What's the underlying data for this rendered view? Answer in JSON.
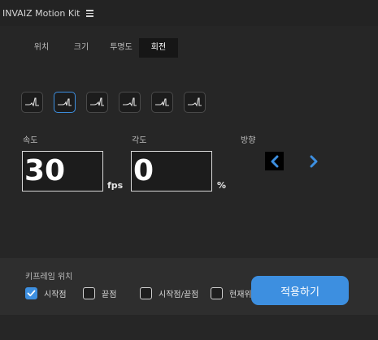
{
  "app": {
    "title": "INVAIZ Motion Kit"
  },
  "tabs": [
    {
      "label": "위치"
    },
    {
      "label": "크기"
    },
    {
      "label": "투명도"
    },
    {
      "label": "회전"
    }
  ],
  "selected_tab": "회전",
  "easing_presets": {
    "count": 6,
    "selected_index": 1
  },
  "fields": {
    "speed": {
      "label": "속도",
      "value": "30",
      "unit": "fps"
    },
    "angle": {
      "label": "각도",
      "value": "0",
      "unit": "%"
    }
  },
  "direction": {
    "label": "방향"
  },
  "keyframe": {
    "label": "키프레임 위치",
    "options": [
      {
        "label": "시작점",
        "checked": true
      },
      {
        "label": "끝점",
        "checked": false
      },
      {
        "label": "시작점/끝점",
        "checked": false
      },
      {
        "label": "현재위치",
        "checked": false
      }
    ]
  },
  "apply": {
    "label": "적용하기"
  },
  "colors": {
    "accent": "#3d8fe0",
    "background": "#262626",
    "bottom_panel": "#2e2e2e"
  },
  "icons": {
    "menu": "hamburger-icon",
    "easing": "easing-curve-icon",
    "left": "chevron-left-icon",
    "right": "chevron-right-icon",
    "check": "checkmark-icon"
  }
}
